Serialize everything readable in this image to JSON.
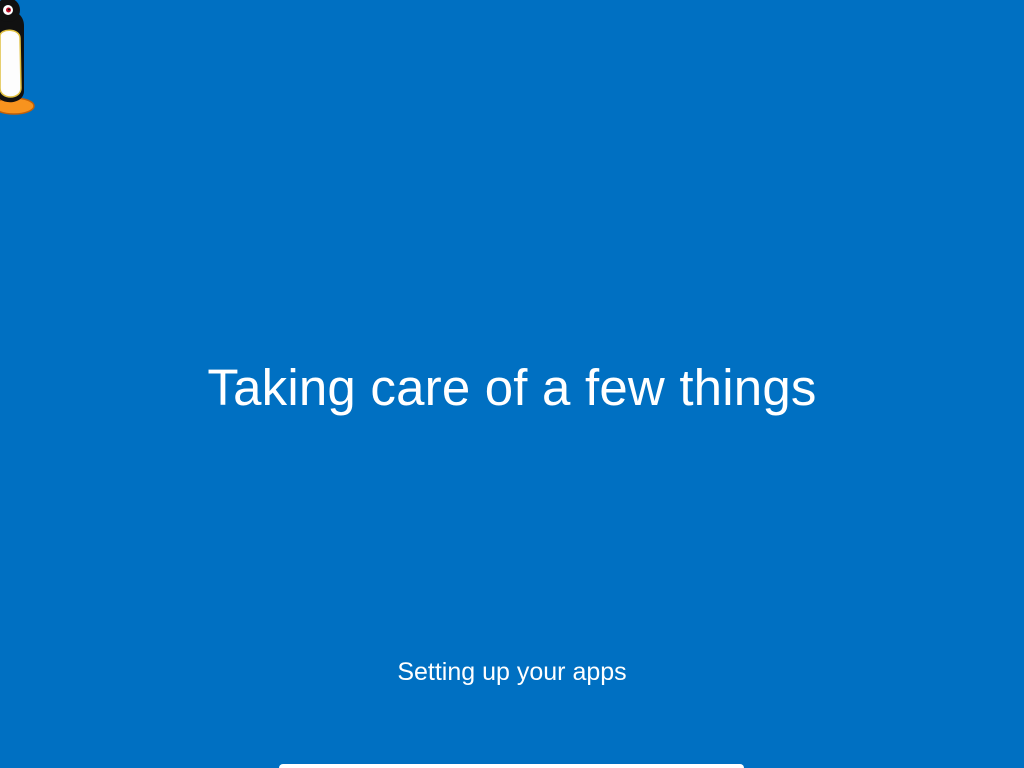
{
  "screen": {
    "headline": "Taking care of a few things",
    "status": "Setting up your apps",
    "background_color": "#0070c2",
    "text_color": "#ffffff"
  },
  "desktop_icon": {
    "icon": "penguin-icon"
  }
}
